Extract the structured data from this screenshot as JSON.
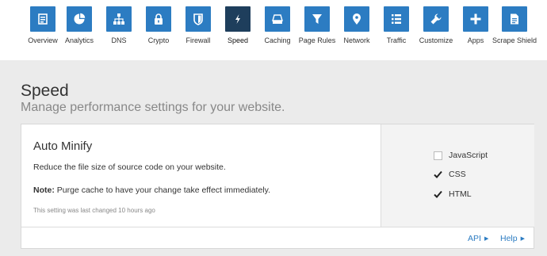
{
  "nav": {
    "items": [
      {
        "label": "Overview",
        "icon": "overview-icon"
      },
      {
        "label": "Analytics",
        "icon": "pie-chart-icon"
      },
      {
        "label": "DNS",
        "icon": "sitemap-icon"
      },
      {
        "label": "Crypto",
        "icon": "lock-icon"
      },
      {
        "label": "Firewall",
        "icon": "shield-icon"
      },
      {
        "label": "Speed",
        "icon": "bolt-icon",
        "active": true
      },
      {
        "label": "Caching",
        "icon": "drive-icon"
      },
      {
        "label": "Page Rules",
        "icon": "filter-icon"
      },
      {
        "label": "Network",
        "icon": "location-pin-icon"
      },
      {
        "label": "Traffic",
        "icon": "list-icon"
      },
      {
        "label": "Customize",
        "icon": "wrench-icon"
      },
      {
        "label": "Apps",
        "icon": "plus-icon"
      },
      {
        "label": "Scrape Shield",
        "icon": "document-icon"
      }
    ]
  },
  "page": {
    "title": "Speed",
    "subtitle": "Manage performance settings for your website."
  },
  "card": {
    "title": "Auto Minify",
    "description": "Reduce the file size of source code on your website.",
    "note_label": "Note:",
    "note_text": " Purge cache to have your change take effect immediately.",
    "last_changed": "This setting was last changed 10 hours ago",
    "options": [
      {
        "label": "JavaScript",
        "checked": false
      },
      {
        "label": "CSS",
        "checked": true
      },
      {
        "label": "HTML",
        "checked": true
      }
    ],
    "footer": {
      "api_label": "API",
      "help_label": "Help"
    }
  },
  "colors": {
    "accent": "#2c7cc2",
    "active": "#1e3e5c"
  }
}
